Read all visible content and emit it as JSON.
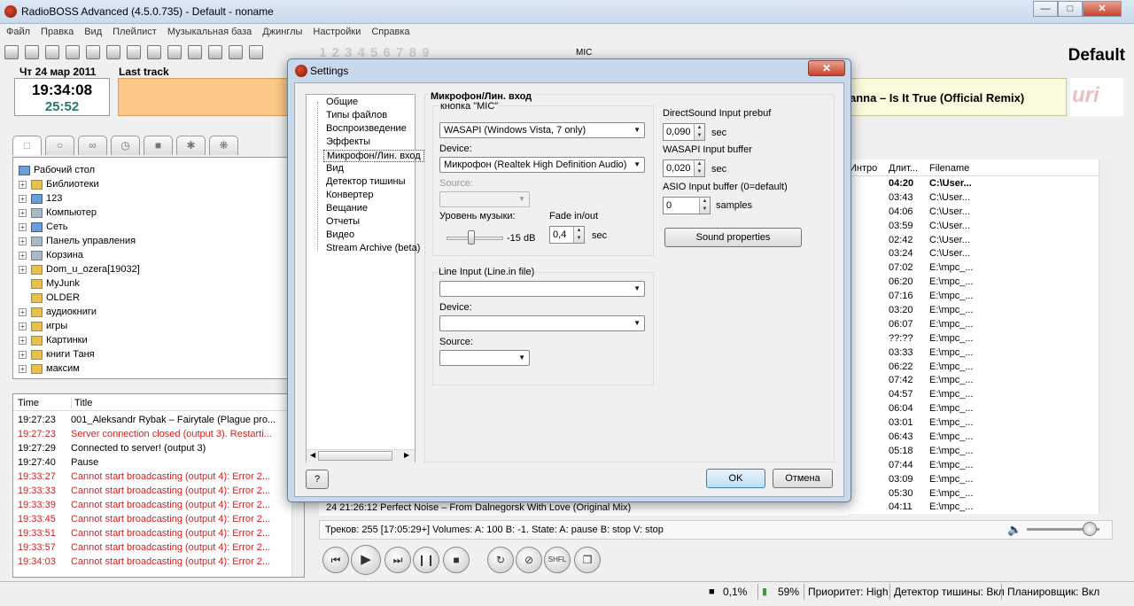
{
  "window": {
    "title": "RadioBOSS Advanced (4.5.0.735) - Default - noname"
  },
  "menu": [
    "Файл",
    "Правка",
    "Вид",
    "Плейлист",
    "Музыкальная база",
    "Джинглы",
    "Настройки",
    "Справка"
  ],
  "toolbar": {
    "mic_label": "MIC",
    "numbers": "1 2 3 4 5 6 7 8 9"
  },
  "header": {
    "playlist_name": "Default",
    "date": "Чт 24 мар 2011",
    "clock": "19:34:08",
    "timer": "25:52",
    "last_track_label": "Last track",
    "now_playing": "anna – Is It True (Official Remix)",
    "logo": "uri"
  },
  "tree": [
    {
      "label": "Рабочий стол",
      "exp": false,
      "icon": "desktop-icon",
      "color": "blue"
    },
    {
      "label": "Библиотеки",
      "exp": true,
      "icon": "library-icon",
      "color": "yellow"
    },
    {
      "label": "123",
      "exp": true,
      "icon": "user-folder-icon",
      "color": "blue"
    },
    {
      "label": "Компьютер",
      "exp": true,
      "icon": "computer-icon",
      "color": "grey"
    },
    {
      "label": "Сеть",
      "exp": true,
      "icon": "network-icon",
      "color": "blue"
    },
    {
      "label": "Панель управления",
      "exp": true,
      "icon": "control-panel-icon",
      "color": "grey"
    },
    {
      "label": "Корзина",
      "exp": true,
      "icon": "recycle-bin-icon",
      "color": "grey"
    },
    {
      "label": "Dom_u_ozera[19032]",
      "exp": true,
      "icon": "folder-icon",
      "color": "yellow"
    },
    {
      "label": "MyJunk",
      "exp": false,
      "icon": "folder-icon",
      "color": "yellow"
    },
    {
      "label": "OLDER",
      "exp": false,
      "icon": "folder-icon",
      "color": "yellow"
    },
    {
      "label": "аудиокниги",
      "exp": true,
      "icon": "folder-icon",
      "color": "yellow"
    },
    {
      "label": "игры",
      "exp": true,
      "icon": "folder-icon",
      "color": "yellow"
    },
    {
      "label": "Картинки",
      "exp": true,
      "icon": "folder-icon",
      "color": "yellow"
    },
    {
      "label": "книги Таня",
      "exp": true,
      "icon": "folder-icon",
      "color": "yellow"
    },
    {
      "label": "максим",
      "exp": true,
      "icon": "folder-icon",
      "color": "yellow"
    }
  ],
  "log": {
    "col_time": "Time",
    "col_title": "Title",
    "rows": [
      {
        "time": "19:27:23",
        "msg": "001_Aleksandr Rybak – Fairytale (Plague pro...",
        "error": false
      },
      {
        "time": "19:27:23",
        "msg": "Server connection closed (output 3). Restarti...",
        "error": true
      },
      {
        "time": "19:27:29",
        "msg": "Connected to server! (output 3)",
        "error": false
      },
      {
        "time": "19:27:40",
        "msg": "Pause",
        "error": false
      },
      {
        "time": "19:33:27",
        "msg": "Cannot start broadcasting (output 4): Error 2...",
        "error": true
      },
      {
        "time": "19:33:33",
        "msg": "Cannot start broadcasting (output 4): Error 2...",
        "error": true
      },
      {
        "time": "19:33:39",
        "msg": "Cannot start broadcasting (output 4): Error 2...",
        "error": true
      },
      {
        "time": "19:33:45",
        "msg": "Cannot start broadcasting (output 4): Error 2...",
        "error": true
      },
      {
        "time": "19:33:51",
        "msg": "Cannot start broadcasting (output 4): Error 2...",
        "error": true
      },
      {
        "time": "19:33:57",
        "msg": "Cannot start broadcasting (output 4): Error 2...",
        "error": true
      },
      {
        "time": "19:34:03",
        "msg": "Cannot start broadcasting (output 4): Error 2...",
        "error": true
      }
    ]
  },
  "playlist": {
    "col_intro": "Интро",
    "col_duration": "Длит...",
    "col_filename": "Filename",
    "behind_row": "24    21:26:12      Perfect Noise – From Dalnegorsk With Love (Original Mix)",
    "rows": [
      {
        "d": "04:20",
        "f": "C:\\User...",
        "current": true
      },
      {
        "d": "03:43",
        "f": "C:\\User...",
        "current": false
      },
      {
        "d": "04:06",
        "f": "C:\\User...",
        "current": false
      },
      {
        "d": "03:59",
        "f": "C:\\User...",
        "current": false
      },
      {
        "d": "02:42",
        "f": "C:\\User...",
        "current": false
      },
      {
        "d": "03:24",
        "f": "C:\\User...",
        "current": false
      },
      {
        "d": "07:02",
        "f": "E:\\mpc_...",
        "current": false
      },
      {
        "d": "06:20",
        "f": "E:\\mpc_...",
        "current": false
      },
      {
        "d": "07:16",
        "f": "E:\\mpc_...",
        "current": false
      },
      {
        "d": "03:20",
        "f": "E:\\mpc_...",
        "current": false
      },
      {
        "d": "06:07",
        "f": "E:\\mpc_...",
        "current": false
      },
      {
        "d": "??:??",
        "f": "E:\\mpc_...",
        "current": false
      },
      {
        "d": "03:33",
        "f": "E:\\mpc_...",
        "current": false
      },
      {
        "d": "06:22",
        "f": "E:\\mpc_...",
        "current": false
      },
      {
        "d": "07:42",
        "f": "E:\\mpc_...",
        "current": false
      },
      {
        "d": "04:57",
        "f": "E:\\mpc_...",
        "current": false
      },
      {
        "d": "06:04",
        "f": "E:\\mpc_...",
        "current": false
      },
      {
        "d": "03:01",
        "f": "E:\\mpc_...",
        "current": false
      },
      {
        "d": "06:43",
        "f": "E:\\mpc_...",
        "current": false
      },
      {
        "d": "05:18",
        "f": "E:\\mpc_...",
        "current": false
      },
      {
        "d": "07:44",
        "f": "E:\\mpc_...",
        "current": false
      },
      {
        "d": "03:09",
        "f": "E:\\mpc_...",
        "current": false
      },
      {
        "d": "05:30",
        "f": "E:\\mpc_...",
        "current": false
      },
      {
        "d": "04:11",
        "f": "E:\\mpc_...",
        "current": false
      }
    ]
  },
  "status": {
    "tracks_info": "Треков: 255 [17:05:29+]     Volumes: A: 100 B: -1. State: A: pause B: stop V: stop",
    "volume": 0.86,
    "cpu": "0,1%",
    "battery": "59%",
    "priority": "Приоритет: High",
    "silence": "Детектор тишины: Вкл",
    "scheduler": "Планировщик: Вкл",
    "shuffle_label": "SHFL"
  },
  "settings": {
    "title": "Settings",
    "nav": [
      "Общие",
      "Типы файлов",
      "Воспроизведение",
      "Эффекты",
      "Микрофон/Лин. вход",
      "Вид",
      "Детектор тишины",
      "Конвертер",
      "Вещание",
      "Отчеты",
      "Видео",
      "Stream Archive (beta)"
    ],
    "selected_index": 4,
    "panel_title": "Микрофон/Лин. вход",
    "mic_button_label": "кнопка \"MIC\"",
    "mic_mode": "WASAPI (Windows Vista, 7 only)",
    "device_label": "Device:",
    "mic_device": "Микрофон (Realtek High Definition Audio)",
    "source_label": "Source:",
    "music_level_label": "Уровень музыки:",
    "music_level_value": "-15 dB",
    "fade_label": "Fade in/out",
    "fade_value": "0,4",
    "sec_label": "sec",
    "line_input_label": "Line Input (Line.in file)",
    "ds_prebuf_label": "DirectSound Input prebuf",
    "ds_prebuf_value": "0,090",
    "wasapi_buf_label": "WASAPI Input buffer",
    "wasapi_buf_value": "0,020",
    "asio_label": "ASIO Input buffer (0=default)",
    "asio_value": "0",
    "samples_label": "samples",
    "sound_props_label": "Sound properties",
    "help_label": "?",
    "ok_label": "OK",
    "cancel_label": "Отмена"
  }
}
